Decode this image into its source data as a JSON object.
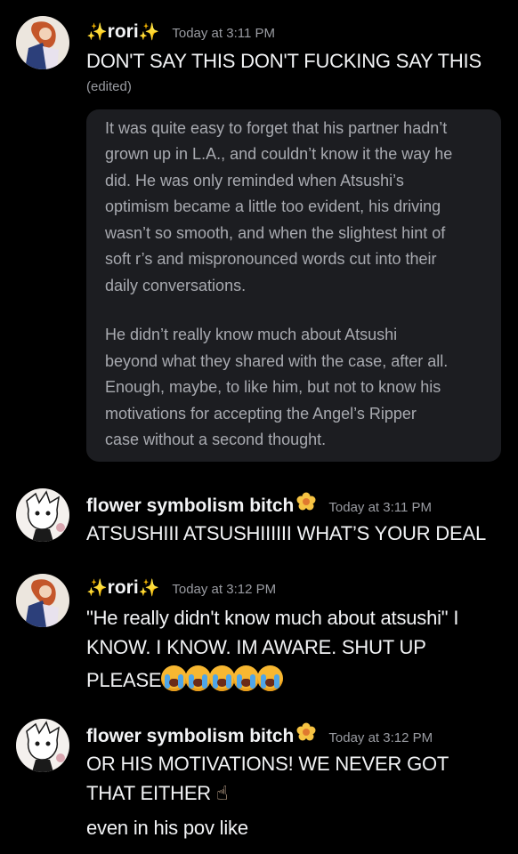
{
  "messages": [
    {
      "username": "rori",
      "username_prefix": "✨",
      "username_suffix": "✨",
      "timestamp": "Today at 3:11 PM",
      "text_lines": [
        "DON'T SAY THIS DON'T FUCKING SAY THIS"
      ],
      "edited": "(edited)",
      "quote_lines": [
        "It was quite easy to forget that his partner hadn’t",
        "grown up in L.A., and couldn’t know it the way he",
        "did. He was only reminded when Atsushi’s",
        "optimism became a little too evident, his driving",
        "wasn’t so smooth, and when the slightest hint of",
        "soft r’s and mispronounced words cut into their",
        "daily conversations.",
        "He didn’t really know much about Atsushi",
        "beyond what they shared with the case, after all.",
        "Enough, maybe, to like him, but not to know his",
        "motivations for accepting the Angel’s Ripper",
        "case without a second thought."
      ]
    },
    {
      "username": "flower symbolism bitch",
      "username_emoji": "flower-emoji",
      "timestamp": "Today at 3:11 PM",
      "text_lines": [
        "ATSUSHIII ATSUSHIIIIII WHAT’S YOUR DEAL"
      ]
    },
    {
      "username": "rori",
      "username_prefix": "✨",
      "username_suffix": "✨",
      "timestamp": "Today at 3:12 PM",
      "text_lines": [
        "\"He really didn't know much about atsushi\" I",
        "KNOW. I KNOW. IM AWARE. SHUT UP",
        "PLEASE"
      ],
      "trailing_emoji": "loudly-crying-face",
      "trailing_emoji_count": 5
    },
    {
      "username": "flower symbolism bitch",
      "username_emoji": "flower-emoji",
      "timestamp": "Today at 3:12 PM",
      "text_lines": [
        "OR HIS MOTIVATIONS! WE NEVER GOT",
        "THAT EITHER"
      ],
      "trailing_emoji": "index-pointing-up",
      "extra_line": "even in his pov like"
    }
  ],
  "colors": {
    "background": "#000000",
    "quote_background": "#1c1d21",
    "username": "#f2f3f5",
    "timestamp": "#9a9ca2",
    "quote_text": "#a8aab0"
  }
}
